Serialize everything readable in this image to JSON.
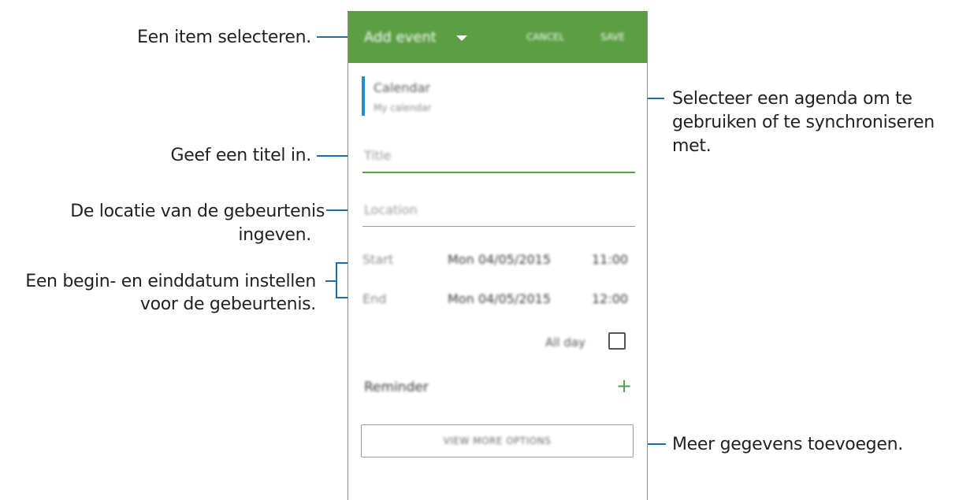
{
  "annotations": {
    "select_item": "Een item selecteren.",
    "enter_title": "Geef een titel in.",
    "location_line1": "De locatie van de gebeurtenis",
    "location_line2": "ingeven.",
    "dates_line1": "Een begin- en einddatum instellen",
    "dates_line2": "voor de gebeurtenis.",
    "calendar_line1": "Selecteer een agenda om te",
    "calendar_line2": "gebruiken of te synchroniseren",
    "calendar_line3": "met.",
    "more_details": "Meer gegevens toevoegen."
  },
  "app": {
    "title": "Add event",
    "cancel": "CANCEL",
    "save": "SAVE",
    "calendar_label": "Calendar",
    "calendar_value": "My calendar",
    "title_placeholder": "Title",
    "location_placeholder": "Location",
    "start_label": "Start",
    "start_date": "Mon 04/05/2015",
    "start_time": "11:00",
    "end_label": "End",
    "end_date": "Mon 04/05/2015",
    "end_time": "12:00",
    "all_day": "All day",
    "all_day_checked": false,
    "reminder": "Reminder",
    "view_more": "VIEW MORE OPTIONS"
  },
  "colors": {
    "appbar": "#5b9e43",
    "accent": "#2f8bc4",
    "leader_line": "#1a6fa3",
    "title_underline": "#5b9e43"
  },
  "icons": {
    "dropdown": "chevron-down-icon",
    "add": "plus-icon",
    "checkbox": "checkbox-icon"
  }
}
